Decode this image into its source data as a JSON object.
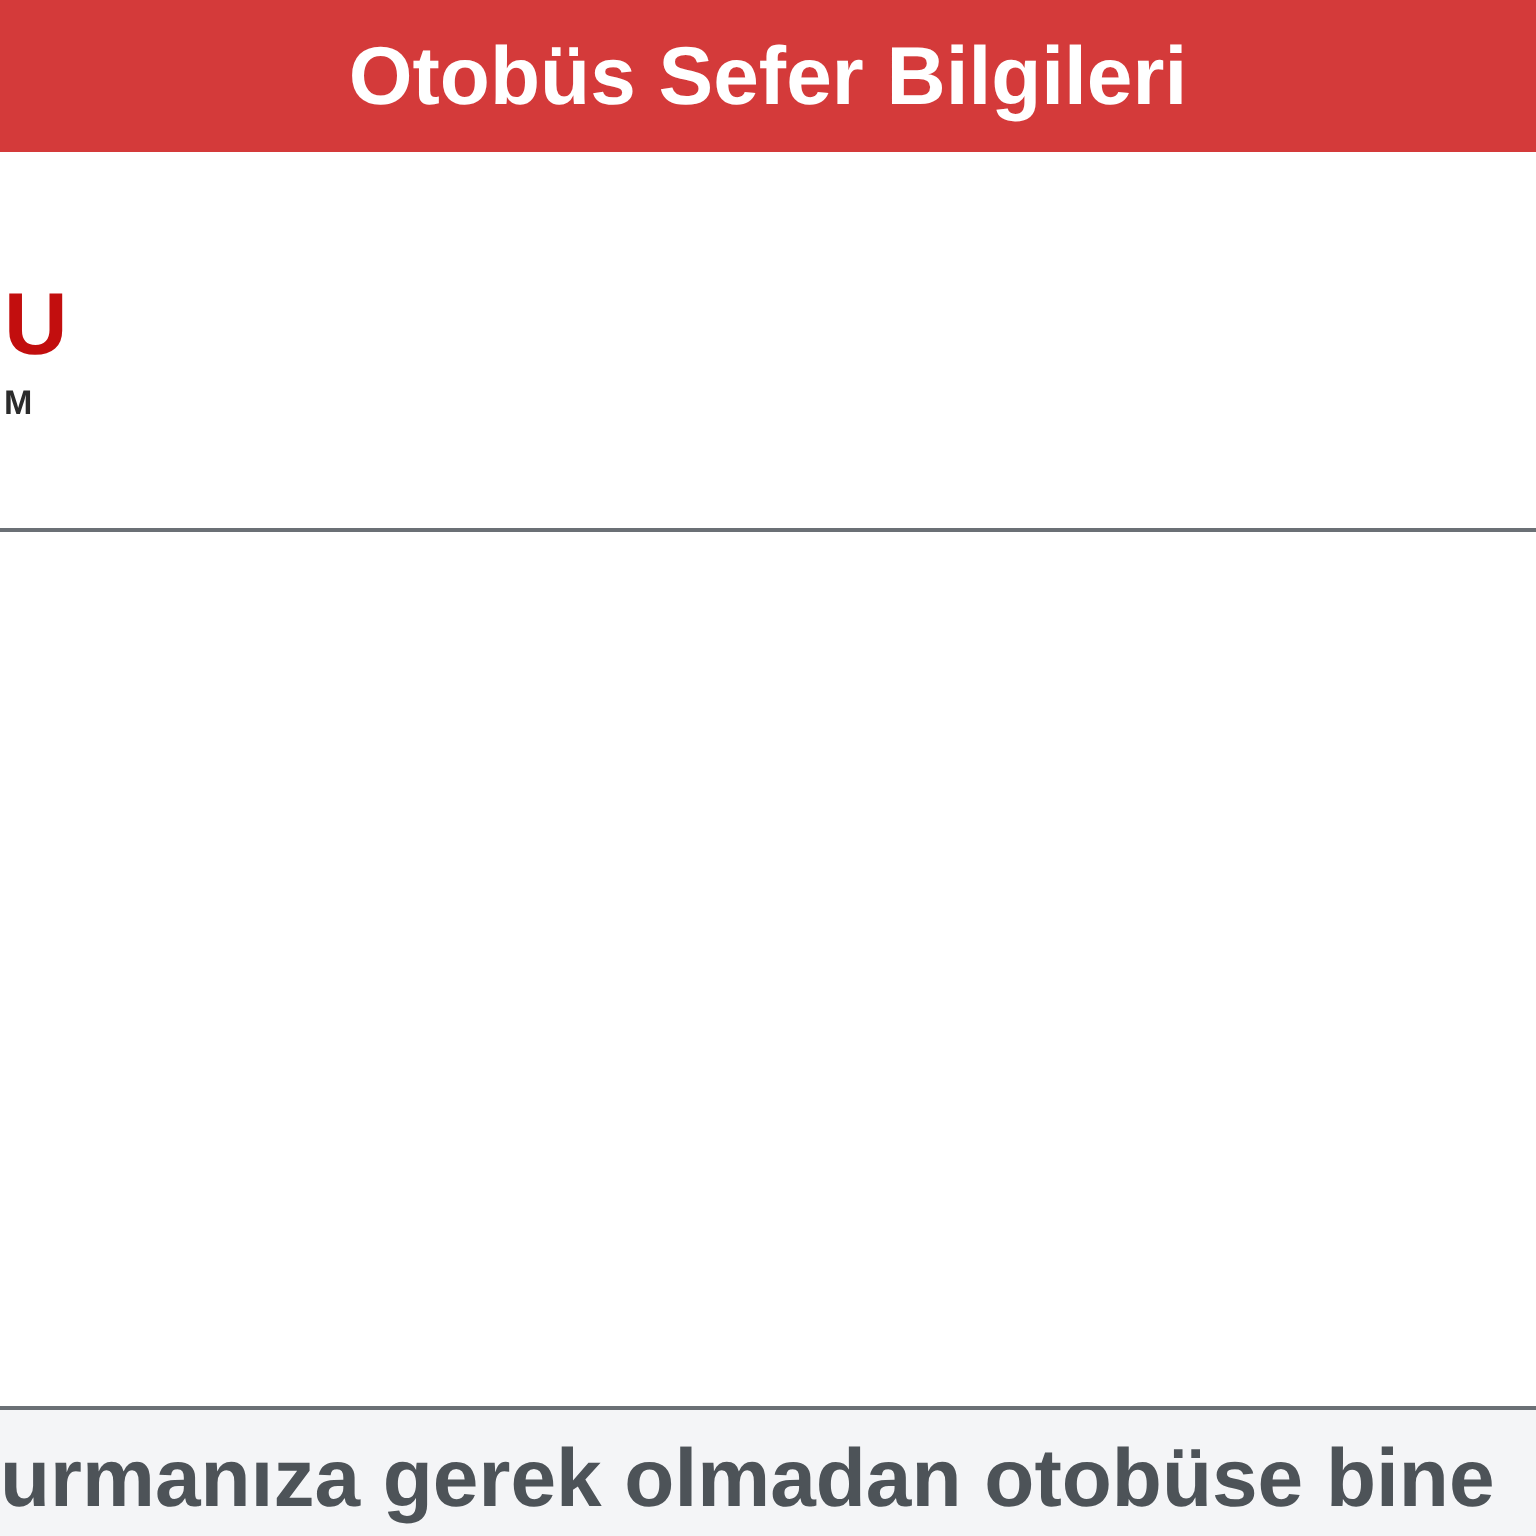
{
  "header": {
    "title": "Otobüs Sefer Bilgileri"
  },
  "logo": {
    "mark": "U",
    "subtext": "M"
  },
  "info_panel": {
    "text": "urmanıza gerek olmadan otobüse bine"
  }
}
